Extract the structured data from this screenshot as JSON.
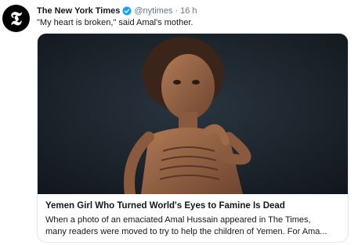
{
  "author": {
    "name": "The New York Times",
    "handle": "@nytimes",
    "separator": "·",
    "time": "16 h",
    "avatar_letter": "𝕿",
    "verified": true
  },
  "tweet": {
    "text": "\"My heart is broken,\" said Amal's mother."
  },
  "card": {
    "title": "Yemen Girl Who Turned World's Eyes to Famine Is Dead",
    "description_line1": "When a photo of an emaciated Amal Hussain appeared in The Times,",
    "description_line2": "many readers were moved to try to help the children of Yemen. For Ama..."
  },
  "colors": {
    "verified_blue": "#1da1f2",
    "text": "#14171a",
    "muted": "#657786",
    "card_border": "#e1e8ed"
  }
}
